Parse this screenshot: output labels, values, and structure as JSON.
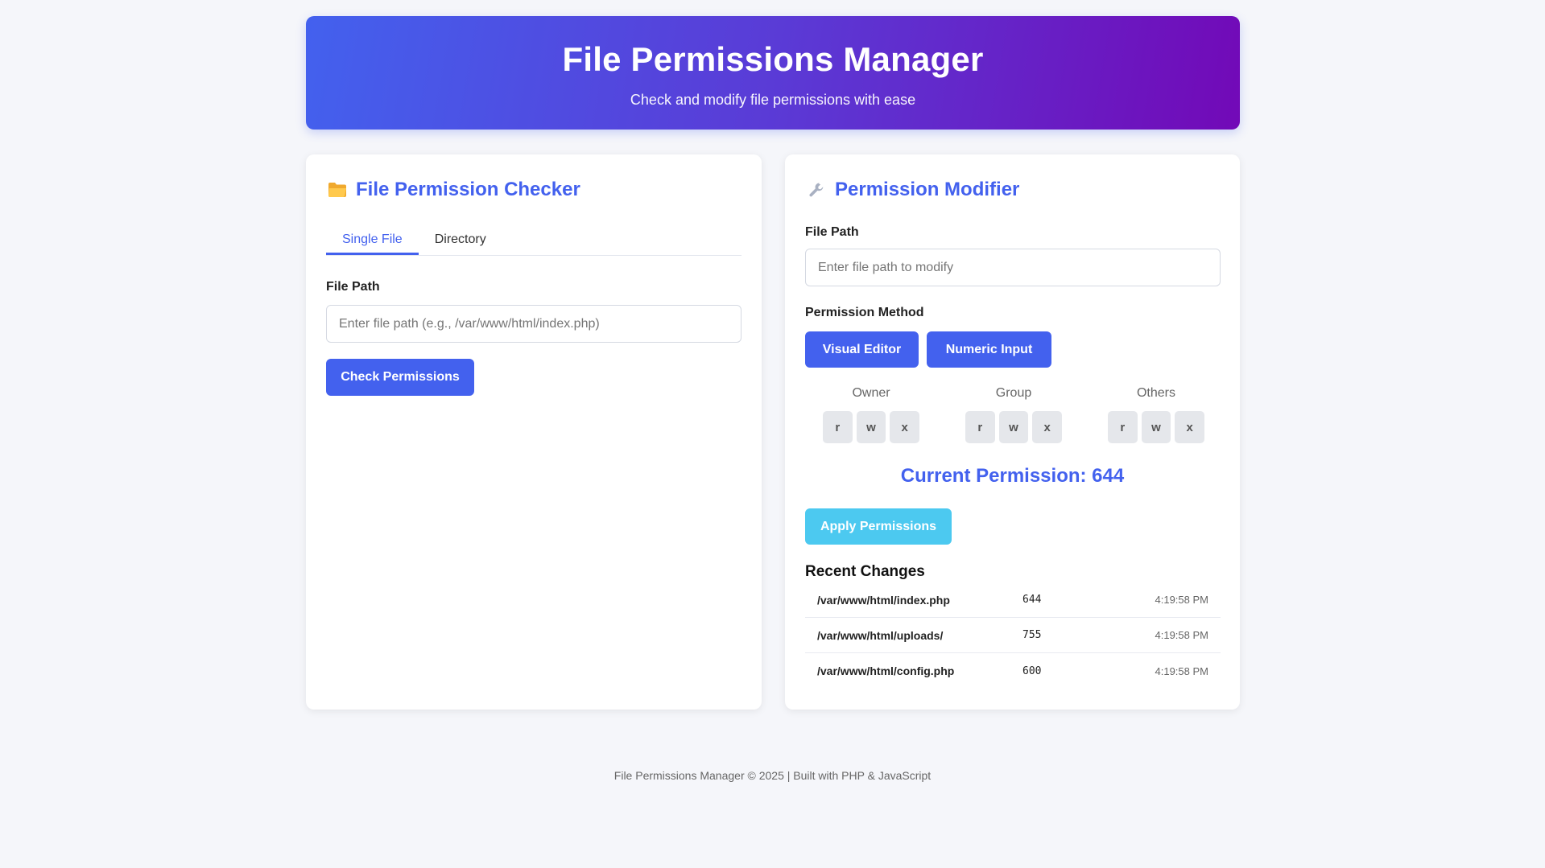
{
  "header": {
    "title": "File Permissions Manager",
    "subtitle": "Check and modify file permissions with ease"
  },
  "checker": {
    "icon": "folder-icon",
    "title": "File Permission Checker",
    "tabs": [
      {
        "label": "Single File",
        "active": true
      },
      {
        "label": "Directory",
        "active": false
      }
    ],
    "file_path_label": "File Path",
    "file_path_placeholder": "Enter file path (e.g., /var/www/html/index.php)",
    "file_path_value": "",
    "check_button": "Check Permissions"
  },
  "modifier": {
    "icon": "wrench-icon",
    "title": "Permission Modifier",
    "file_path_label": "File Path",
    "file_path_placeholder": "Enter file path to modify",
    "file_path_value": "",
    "method_label": "Permission Method",
    "visual_editor_button": "Visual Editor",
    "numeric_input_button": "Numeric Input",
    "groups": [
      {
        "name": "Owner",
        "bits": [
          "r",
          "w",
          "x"
        ]
      },
      {
        "name": "Group",
        "bits": [
          "r",
          "w",
          "x"
        ]
      },
      {
        "name": "Others",
        "bits": [
          "r",
          "w",
          "x"
        ]
      }
    ],
    "current_permission": "Current Permission: 644",
    "apply_button": "Apply Permissions",
    "recent_title": "Recent Changes",
    "recent_changes": [
      {
        "path": "/var/www/html/index.php",
        "perm": "644",
        "time": "4:19:58 PM"
      },
      {
        "path": "/var/www/html/uploads/",
        "perm": "755",
        "time": "4:19:58 PM"
      },
      {
        "path": "/var/www/html/config.php",
        "perm": "600",
        "time": "4:19:58 PM"
      }
    ]
  },
  "footer": {
    "text": "File Permissions Manager © 2025 | Built with PHP & JavaScript"
  },
  "colors": {
    "primary": "#4361ee",
    "accent_purple": "#7209b7",
    "apply_cyan": "#4cc9f0",
    "background": "#f5f6fa"
  }
}
